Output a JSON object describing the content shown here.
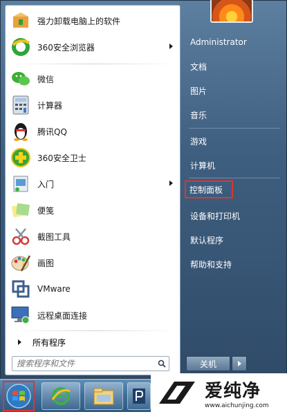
{
  "programs": [
    {
      "label": "强力卸载电脑上的软件",
      "icon": "uninstall-box-icon",
      "has_arrow": false
    },
    {
      "label": "360安全浏览器",
      "icon": "360-browser-icon",
      "has_arrow": true
    },
    {
      "label": "微信",
      "icon": "wechat-icon",
      "has_arrow": false
    },
    {
      "label": "计算器",
      "icon": "calculator-icon",
      "has_arrow": false
    },
    {
      "label": "腾讯QQ",
      "icon": "qq-penguin-icon",
      "has_arrow": false
    },
    {
      "label": "360安全卫士",
      "icon": "360-safeguard-icon",
      "has_arrow": false
    },
    {
      "label": "入门",
      "icon": "getting-started-icon",
      "has_arrow": true
    },
    {
      "label": "便笺",
      "icon": "sticky-notes-icon",
      "has_arrow": false
    },
    {
      "label": "截图工具",
      "icon": "snipping-tool-icon",
      "has_arrow": false
    },
    {
      "label": "画图",
      "icon": "paint-palette-icon",
      "has_arrow": false
    },
    {
      "label": "VMware",
      "icon": "vmware-icon",
      "has_arrow": false
    },
    {
      "label": "远程桌面连接",
      "icon": "remote-desktop-icon",
      "has_arrow": false
    }
  ],
  "all_programs_label": "所有程序",
  "search": {
    "placeholder": "搜索程序和文件"
  },
  "right_pane": {
    "items": [
      {
        "label": "Administrator"
      },
      {
        "label": "文档"
      },
      {
        "label": "图片"
      },
      {
        "label": "音乐"
      },
      {
        "label": "游戏"
      },
      {
        "label": "计算机"
      },
      {
        "label": "控制面板"
      },
      {
        "label": "设备和打印机"
      },
      {
        "label": "默认程序"
      },
      {
        "label": "帮助和支持"
      }
    ],
    "shutdown_label": "关机"
  },
  "watermark": {
    "brand": "爱纯净",
    "url": "www.aichunjing.com"
  },
  "colors": {
    "highlight": "#e23232",
    "menu_blue": "#3f5f80",
    "taskbar": "#3d6d98"
  }
}
